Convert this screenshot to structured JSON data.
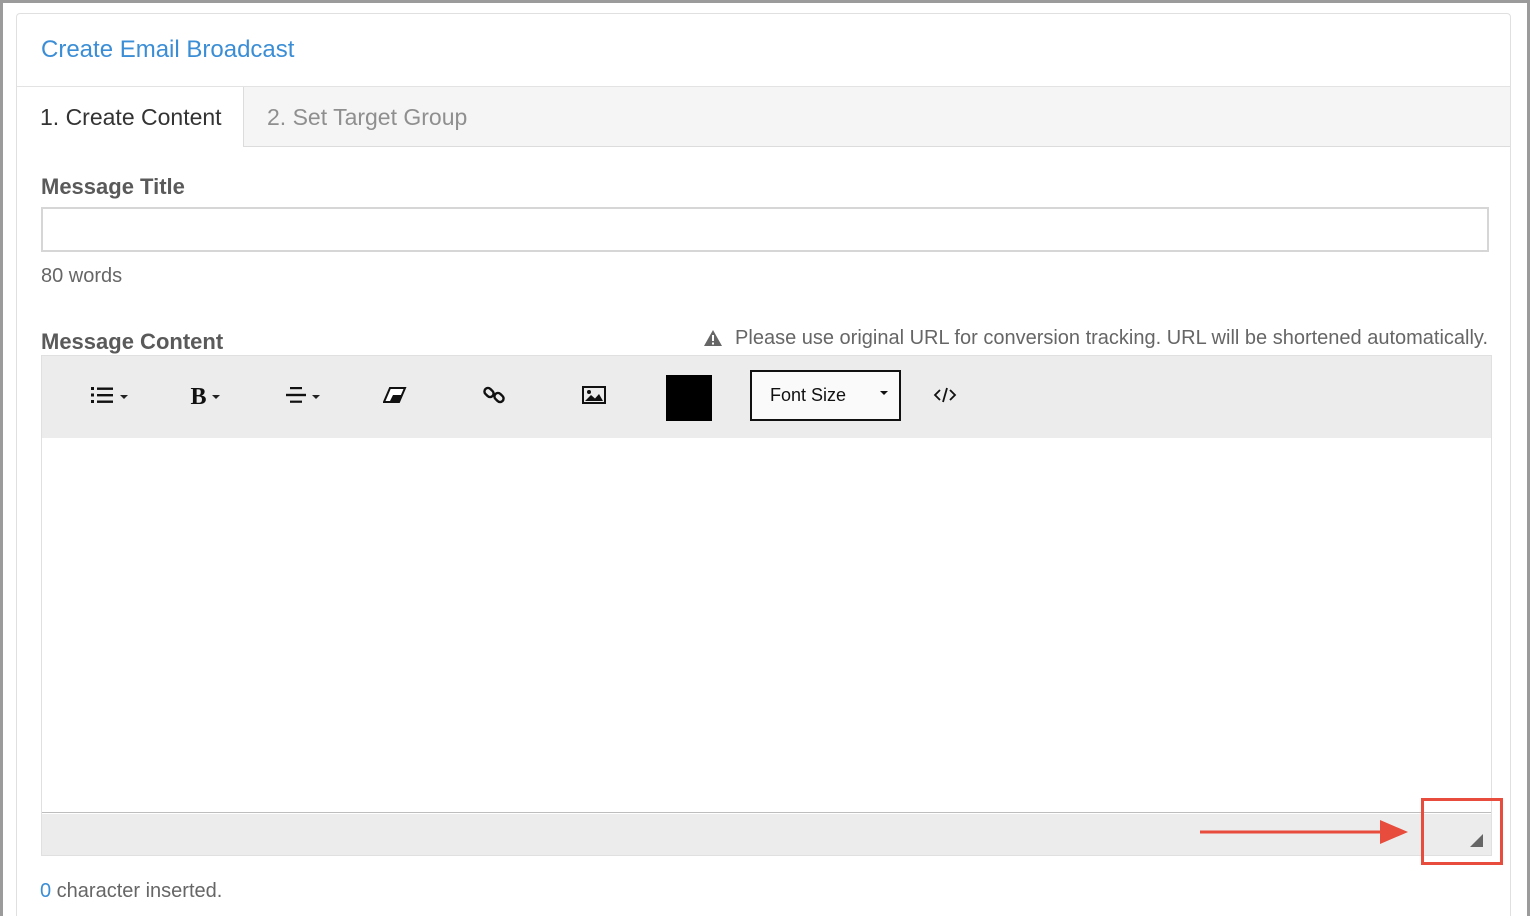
{
  "panel": {
    "title": "Create Email Broadcast"
  },
  "tabs": [
    {
      "label": "1. Create Content",
      "active": true
    },
    {
      "label": "2. Set Target Group",
      "active": false
    }
  ],
  "form": {
    "message_title_label": "Message Title",
    "message_title_value": "",
    "message_title_placeholder": "",
    "word_limit": "80 words",
    "message_content_label": "Message Content",
    "warning_text": "Please use original URL for conversion tracking. URL will be shortened automatically."
  },
  "toolbar": {
    "icons": [
      "list-icon",
      "bold-icon",
      "align-icon",
      "eraser-icon",
      "link-icon",
      "image-icon",
      "code-view-icon"
    ],
    "text_color": "#000000",
    "font_size_label": "Font Size"
  },
  "footer": {
    "char_count": "0",
    "char_suffix": " character inserted."
  },
  "annotation_color": "#e74c3c",
  "accent_color": "#3b8ed6"
}
